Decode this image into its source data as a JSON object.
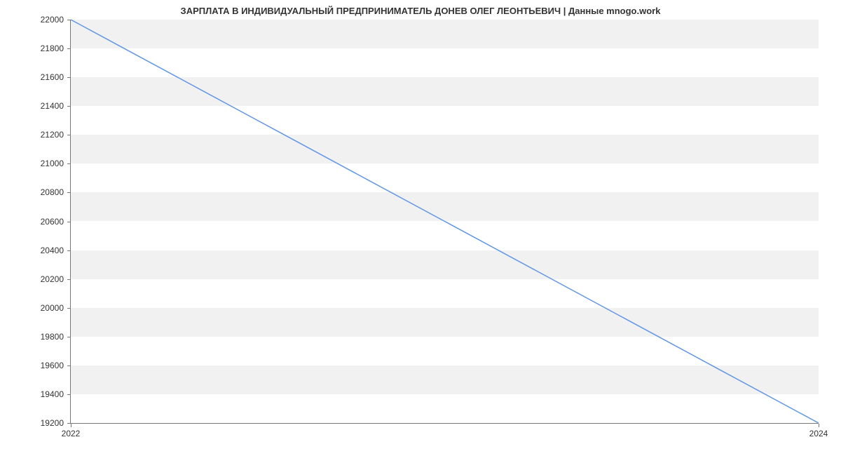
{
  "chart_data": {
    "type": "line",
    "title": "ЗАРПЛАТА В ИНДИВИДУАЛЬНЫЙ ПРЕДПРИНИМАТЕЛЬ ДОНЕВ ОЛЕГ ЛЕОНТЬЕВИЧ | Данные mnogo.work",
    "xlabel": "",
    "ylabel": "",
    "x": [
      2022,
      2024
    ],
    "values": [
      22000,
      19200
    ],
    "xlim": [
      2022,
      2024
    ],
    "ylim": [
      19200,
      22000
    ],
    "xticks": [
      2022,
      2024
    ],
    "yticks": [
      19200,
      19400,
      19600,
      19800,
      20000,
      20200,
      20400,
      20600,
      20800,
      21000,
      21200,
      21400,
      21600,
      21800,
      22000
    ],
    "line_color": "#6096e6",
    "grid_band_color": "#f1f1f1"
  }
}
